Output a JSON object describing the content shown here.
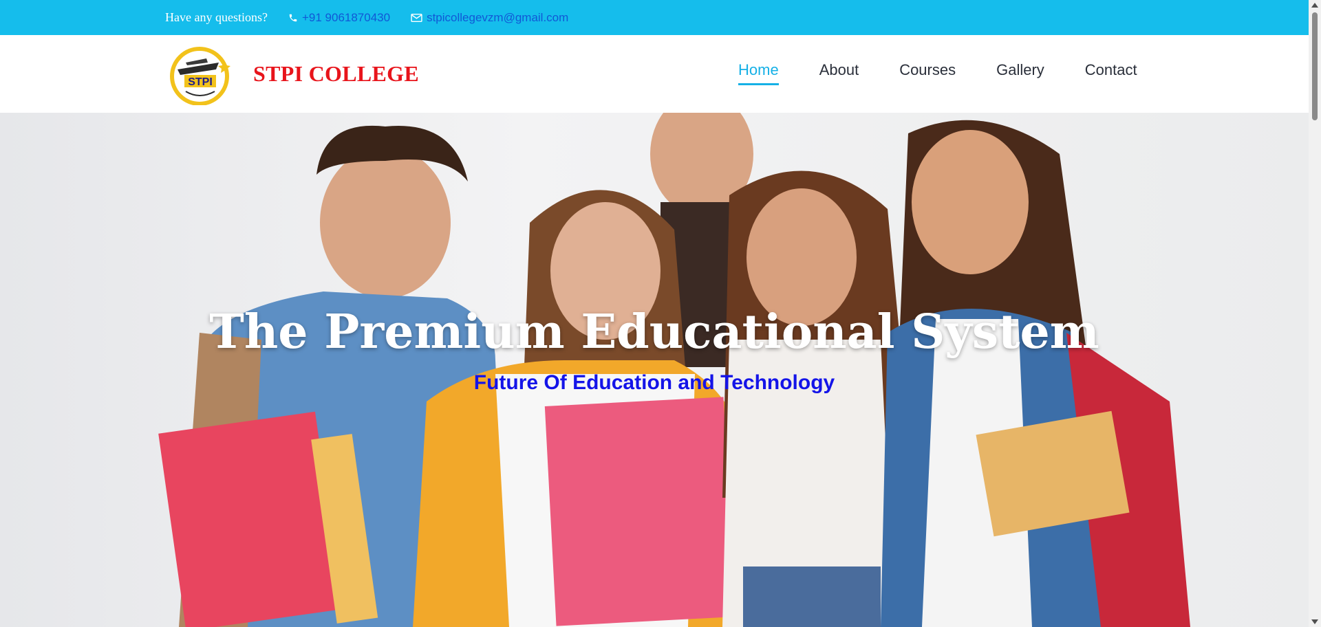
{
  "topbar": {
    "question": "Have any questions?",
    "phone": "+91 9061870430",
    "email": "stpicollegevzm@gmail.com",
    "phone_icon": "phone-icon",
    "email_icon": "envelope-icon"
  },
  "header": {
    "logo_text": "STPI",
    "brand": "STPI COLLEGE"
  },
  "nav": {
    "items": [
      {
        "label": "Home",
        "active": true
      },
      {
        "label": "About"
      },
      {
        "label": "Courses"
      },
      {
        "label": "Gallery"
      },
      {
        "label": "Contact"
      }
    ]
  },
  "hero": {
    "title": "The Premium Educational System",
    "subtitle": "Future Of Education and Technology"
  },
  "colors": {
    "topbar": "#15bdec",
    "brand": "#e8141b",
    "nav_active": "#15b0e6",
    "subtitle": "#1414e8"
  }
}
